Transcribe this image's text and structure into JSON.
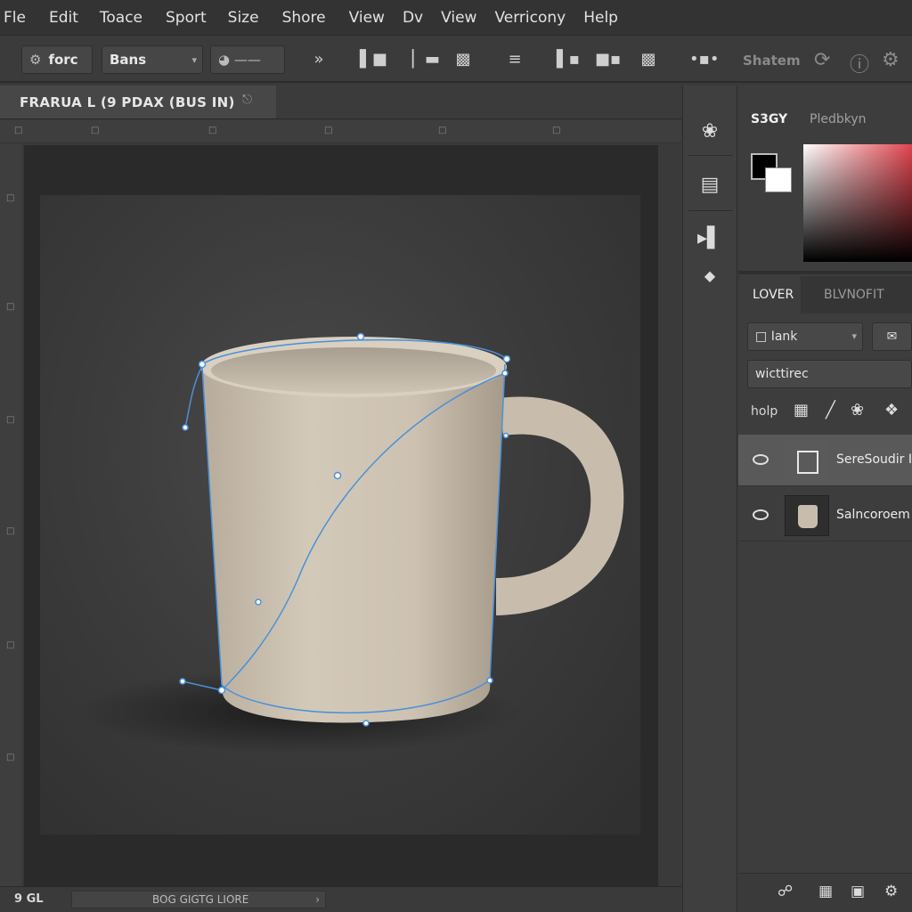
{
  "menu": [
    "Fle",
    "Edit",
    "Toace",
    "Sport",
    "Size",
    "Shore",
    "View",
    "Dv",
    "View",
    "Verricony",
    "Help"
  ],
  "options": {
    "preset_label": "forc",
    "mode_label": "Bans",
    "right_label": "Shatem"
  },
  "document": {
    "tab_title": "FRARUA L (9 PDAX (BUS IN)",
    "zoom": "9 GL",
    "status": "BOG GIGTG LIORE"
  },
  "color_panel": {
    "tab_active": "S3GY",
    "tab_other": "Pledbkyn",
    "foreground": "#000000",
    "background": "#ffffff",
    "picker_hue": "#e0404a"
  },
  "layers_panel": {
    "tab_active": "LOVER",
    "tab_other": "BLVNOFIT",
    "blend_label": "Iank",
    "filter_value": "wicttirec",
    "lock_label": "holp",
    "layers": [
      {
        "name": "SereSoudir I",
        "selected": true
      },
      {
        "name": "Salncoroem",
        "selected": false
      }
    ]
  },
  "icons": {
    "toolbar": [
      "move-icon",
      "align-left-icon",
      "align-center-icon",
      "align-right-icon",
      "distribute-icon",
      "align-top-icon",
      "align-middle-icon",
      "align-bottom-icon",
      "more-icon"
    ],
    "strip": [
      "brush-icon",
      "history-icon",
      "play-icon",
      "info-icon"
    ],
    "footer": [
      "link-icon",
      "fx-icon",
      "mask-icon",
      "new-layer-icon"
    ]
  }
}
